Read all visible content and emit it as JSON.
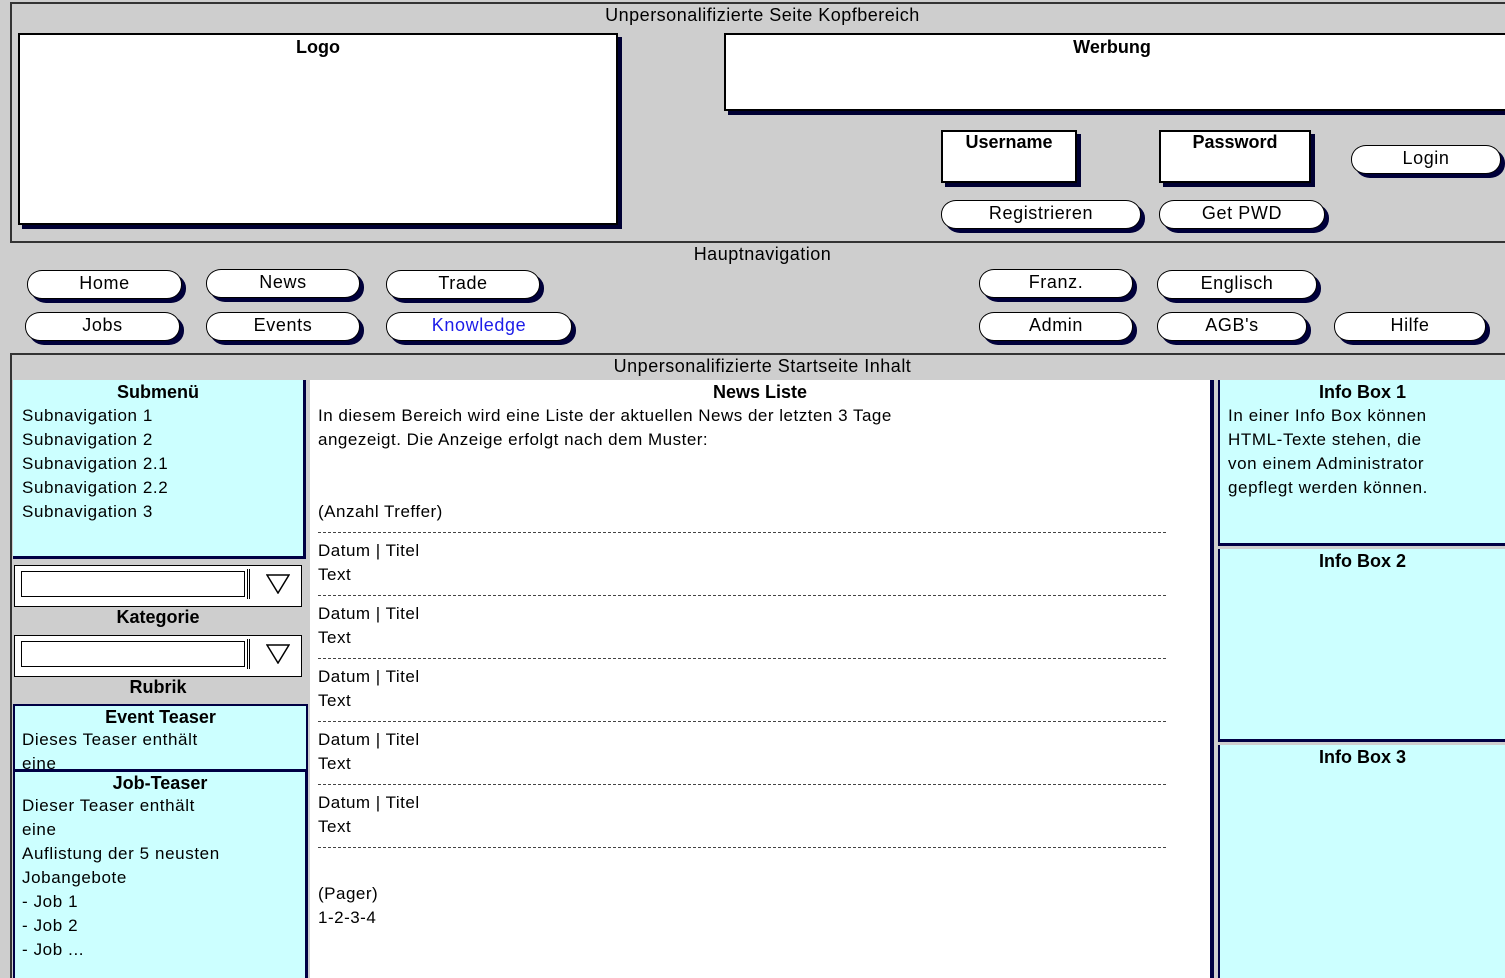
{
  "header": {
    "section_title": "Unpersonalifizierte Seite Kopfbereich",
    "logo_label": "Logo",
    "ad_label": "Werbung",
    "username_label": "Username",
    "password_label": "Password",
    "login_label": "Login",
    "register_label": "Registrieren",
    "getpwd_label": "Get PWD"
  },
  "nav": {
    "section_title": "Hauptnavigation",
    "items": [
      {
        "label": "Home"
      },
      {
        "label": "News"
      },
      {
        "label": "Trade"
      },
      {
        "label": "Jobs"
      },
      {
        "label": "Events"
      },
      {
        "label": "Knowledge"
      },
      {
        "label": "Franz."
      },
      {
        "label": "Englisch"
      },
      {
        "label": "Admin"
      },
      {
        "label": "AGB's"
      },
      {
        "label": "Hilfe"
      }
    ]
  },
  "content": {
    "section_title": "Unpersonalifizierte Startseite Inhalt",
    "submenu": {
      "title": "Submenü",
      "items": [
        "Subnavigation 1",
        "Subnavigation 2",
        "Subnavigation 2.1",
        "Subnavigation 2.2",
        "Subnavigation 3"
      ]
    },
    "category_label": "Kategorie",
    "rubric_label": "Rubrik",
    "event_teaser": {
      "title": "Event Teaser",
      "lines": [
        "Dieses Teaser enthält",
        "eine"
      ]
    },
    "job_teaser": {
      "title": "Job-Teaser",
      "lines": [
        "Dieser Teaser enthält",
        "eine",
        "Auflistung der 5 neusten",
        "Jobangebote",
        "- Job 1",
        "- Job 2",
        "- Job ..."
      ]
    },
    "news": {
      "title": "News Liste",
      "intro_1": "In diesem Bereich wird eine Liste der aktuellen News der letzten 3 Tage",
      "intro_2": "angezeigt. Die Anzeige erfolgt nach dem Muster:",
      "count_label": "(Anzahl Treffer)",
      "entries": [
        {
          "head": "Datum | Titel",
          "body": "Text"
        },
        {
          "head": "Datum | Titel",
          "body": "Text"
        },
        {
          "head": "Datum | Titel",
          "body": "Text"
        },
        {
          "head": "Datum | Titel",
          "body": "Text"
        },
        {
          "head": "Datum | Titel",
          "body": "Text"
        }
      ],
      "pager_label": "(Pager)",
      "pager_pages": "1-2-3-4"
    },
    "info_boxes": [
      {
        "title": "Info Box 1",
        "lines": [
          "In einer Info Box können",
          "HTML-Texte stehen, die",
          "von einem Administrator",
          "gepflegt werden können."
        ]
      },
      {
        "title": "Info Box 2",
        "lines": []
      },
      {
        "title": "Info Box 3",
        "lines": []
      }
    ]
  },
  "colors": {
    "background": "#cecece",
    "panel": "#ccffff",
    "link_active": "#1c1ce8"
  }
}
